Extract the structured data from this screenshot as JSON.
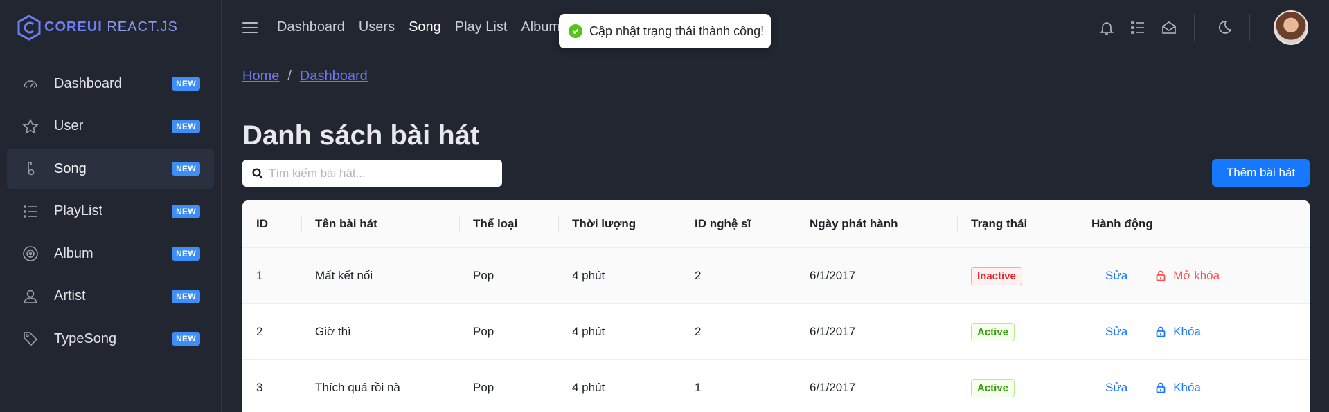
{
  "brand": {
    "name_bold": "COREUI",
    "name_light": "REACT.JS"
  },
  "sidebar": {
    "items": [
      {
        "label": "Dashboard",
        "badge": "NEW",
        "icon": "speedometer-icon"
      },
      {
        "label": "User",
        "badge": "NEW",
        "icon": "star-icon"
      },
      {
        "label": "Song",
        "badge": "NEW",
        "icon": "music-note-icon",
        "active": true
      },
      {
        "label": "PlayList",
        "badge": "NEW",
        "icon": "list-icon"
      },
      {
        "label": "Album",
        "badge": "NEW",
        "icon": "disc-icon"
      },
      {
        "label": "Artist",
        "badge": "NEW",
        "icon": "user-icon"
      },
      {
        "label": "TypeSong",
        "badge": "NEW",
        "icon": "tag-icon"
      }
    ]
  },
  "header": {
    "links": [
      "Dashboard",
      "Users",
      "Song",
      "Play List",
      "Album"
    ],
    "current": "Song",
    "icons": [
      "bell-icon",
      "list-icon",
      "envelope-icon",
      "moon-icon"
    ]
  },
  "toast": {
    "message": "Cập nhật trạng thái thành công!",
    "type": "success"
  },
  "breadcrumb": {
    "home": "Home",
    "separator": "/",
    "current": "Dashboard"
  },
  "page": {
    "title": "Danh sách bài hát",
    "search_placeholder": "Tìm kiếm bài hát...",
    "add_button": "Thêm bài hát"
  },
  "table": {
    "columns": [
      "ID",
      "Tên bài hát",
      "Thể loại",
      "Thời lượng",
      "ID nghệ sĩ",
      "Ngày phát hành",
      "Trạng thái",
      "Hành động"
    ],
    "rows": [
      {
        "id": "1",
        "name": "Mất kết nối",
        "genre": "Pop",
        "duration": "4 phút",
        "artist_id": "2",
        "release": "6/1/2017",
        "status": "Inactive",
        "edit": "Sửa",
        "lock_action": "Mở khóa"
      },
      {
        "id": "2",
        "name": "Giờ thì",
        "genre": "Pop",
        "duration": "4 phút",
        "artist_id": "2",
        "release": "6/1/2017",
        "status": "Active",
        "edit": "Sửa",
        "lock_action": "Khóa"
      },
      {
        "id": "3",
        "name": "Thích quá rồi nà",
        "genre": "Pop",
        "duration": "4 phút",
        "artist_id": "1",
        "release": "6/1/2017",
        "status": "Active",
        "edit": "Sửa",
        "lock_action": "Khóa"
      }
    ]
  },
  "colors": {
    "primary": "#1677ff",
    "accent": "#6f76f1",
    "badge": "#3d8ef7",
    "success": "#52c41a",
    "danger": "#ff4d4f"
  }
}
